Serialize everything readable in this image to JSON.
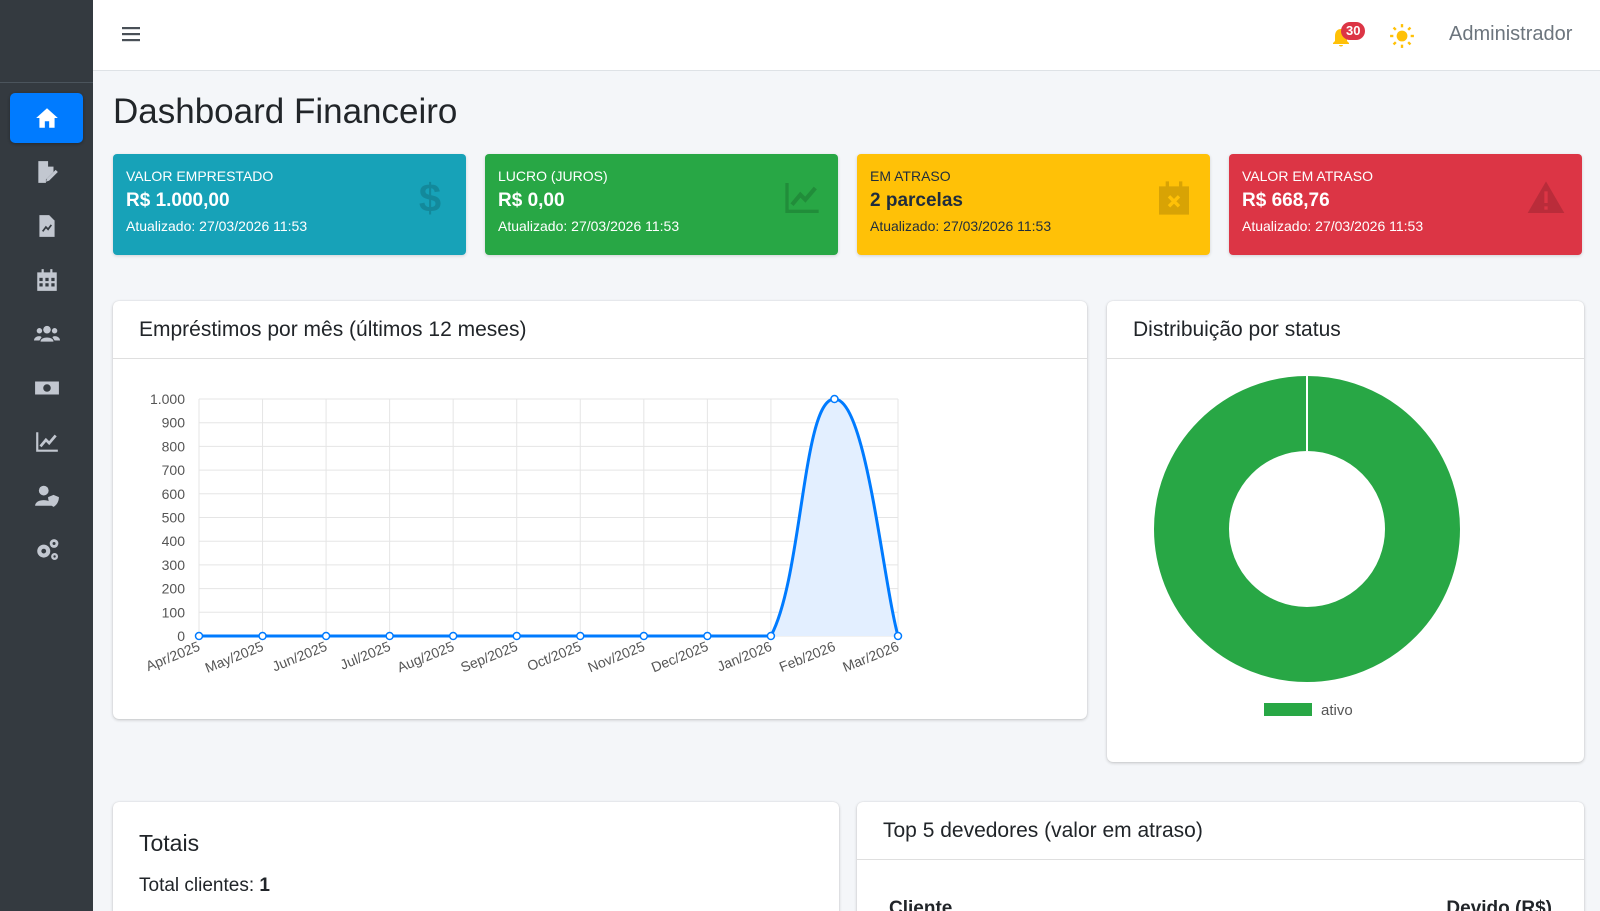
{
  "topbar": {
    "notification_count": "30",
    "user_name": "Administrador"
  },
  "page": {
    "title": "Dashboard Financeiro"
  },
  "info_boxes": [
    {
      "label": "Valor Emprestado",
      "value": "R$ 1.000,00",
      "updated": "Atualizado: 27/03/2026 11:53",
      "icon": "dollar-icon",
      "color": "#17a2b8"
    },
    {
      "label": "Lucro (Juros)",
      "value": "R$ 0,00",
      "updated": "Atualizado: 27/03/2026 11:53",
      "icon": "chart-line-icon",
      "color": "#28a745"
    },
    {
      "label": "Em Atraso",
      "value": "2 parcelas",
      "updated": "Atualizado: 27/03/2026 11:53",
      "icon": "calendar-x-icon",
      "color": "#ffc107"
    },
    {
      "label": "Valor em Atraso",
      "value": "R$ 668,76",
      "updated": "Atualizado: 27/03/2026 11:53",
      "icon": "warning-icon",
      "color": "#dc3545"
    }
  ],
  "sidebar": {
    "items": [
      {
        "icon": "home-icon",
        "active": true
      },
      {
        "icon": "file-signature-icon"
      },
      {
        "icon": "file-invoice-icon"
      },
      {
        "icon": "calendar-icon"
      },
      {
        "icon": "users-icon"
      },
      {
        "icon": "money-bill-icon"
      },
      {
        "icon": "chart-line-icon"
      },
      {
        "icon": "user-shield-icon"
      },
      {
        "icon": "cogs-icon"
      }
    ]
  },
  "cards": {
    "line_title": "Empréstimos por mês (últimos 12 meses)",
    "donut_title": "Distribuição por status",
    "totais_title": "Totais",
    "totais_clientes_label": "Total clientes:",
    "totais_clientes_value": "1",
    "top5_title": "Top 5 devedores (valor em atraso)",
    "top5_col_cliente": "Cliente",
    "top5_col_devido": "Devido (R$)"
  },
  "chart_data": [
    {
      "type": "area",
      "title": "Empréstimos por mês (últimos 12 meses)",
      "categories": [
        "Apr/2025",
        "May/2025",
        "Jun/2025",
        "Jul/2025",
        "Aug/2025",
        "Sep/2025",
        "Oct/2025",
        "Nov/2025",
        "Dec/2025",
        "Jan/2026",
        "Feb/2026",
        "Mar/2026"
      ],
      "values": [
        0,
        0,
        0,
        0,
        0,
        0,
        0,
        0,
        0,
        0,
        1000,
        0
      ],
      "yticks": [
        "0",
        "100",
        "200",
        "300",
        "400",
        "500",
        "600",
        "700",
        "800",
        "900",
        "1.000"
      ],
      "ylim": [
        0,
        1000
      ],
      "grid": true,
      "line_color": "#007bff",
      "fill_color": "#e3efff"
    },
    {
      "type": "pie",
      "title": "Distribuição por status",
      "labels": [
        "ativo"
      ],
      "values": [
        1
      ],
      "colors": [
        "#28a745"
      ],
      "legend": "bottom"
    }
  ]
}
